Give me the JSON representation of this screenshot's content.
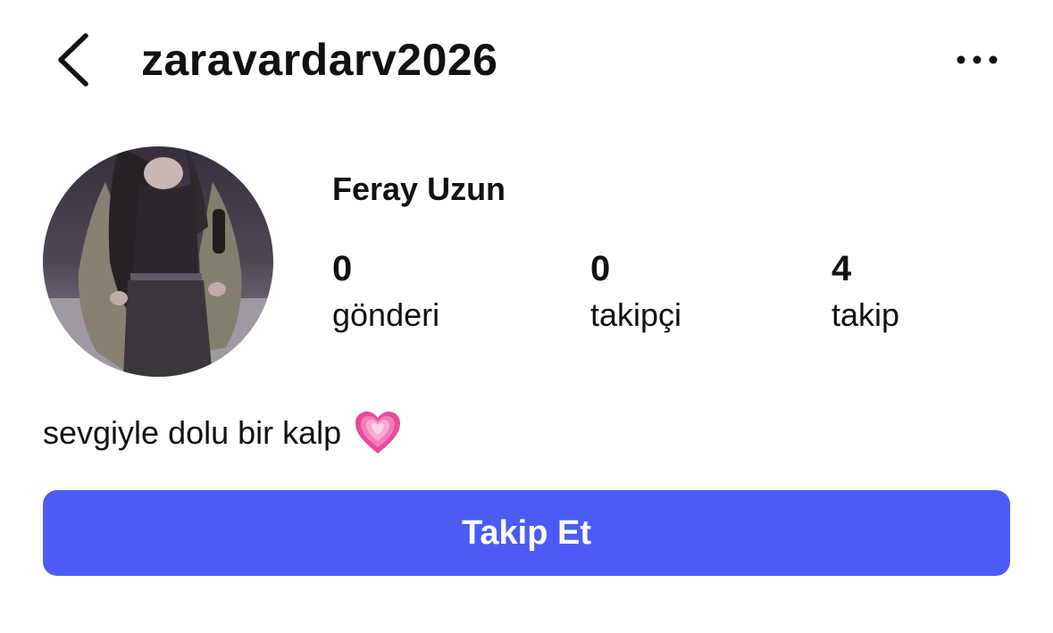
{
  "header": {
    "back_icon": "chevron-left-icon",
    "username": "zaravardarv2026",
    "more_icon": "ellipsis-icon"
  },
  "profile": {
    "display_name": "Feray Uzun",
    "stats": [
      {
        "value": "0",
        "label": "gönderi"
      },
      {
        "value": "0",
        "label": "takipçi"
      },
      {
        "value": "4",
        "label": "takip"
      }
    ],
    "bio": "sevgiyle dolu bir kalp",
    "bio_emoji": "growing-heart-icon"
  },
  "actions": {
    "follow_label": "Takip Et"
  },
  "colors": {
    "accent": "#4b5cf5",
    "heart": "#f06bb3"
  }
}
